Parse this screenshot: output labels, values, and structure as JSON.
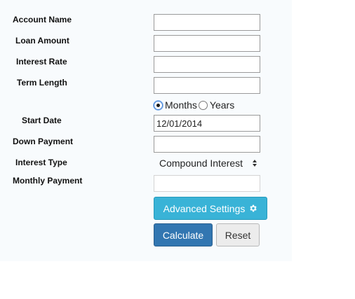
{
  "form": {
    "labels": {
      "account_name": "Account Name",
      "loan_amount": "Loan Amount",
      "interest_rate": "Interest Rate",
      "term_length": "Term Length",
      "start_date": "Start Date",
      "down_payment": "Down Payment",
      "interest_type": "Interest Type",
      "monthly_payment": "Monthly Payment"
    },
    "values": {
      "account_name": "",
      "loan_amount": "",
      "interest_rate": "",
      "term_length": "",
      "start_date": "12/01/2014",
      "down_payment": "",
      "monthly_payment": ""
    },
    "term_unit": {
      "options": [
        "Months",
        "Years"
      ],
      "selected": "Months"
    },
    "interest_type": {
      "selected": "Compound Interest"
    }
  },
  "buttons": {
    "advanced_settings": "Advanced Settings",
    "calculate": "Calculate",
    "reset": "Reset"
  },
  "icons": {
    "advanced_settings_icon": "gear-icon",
    "select_arrows_icon": "updown-arrows-icon"
  },
  "colors": {
    "info_button": "#39b3d7",
    "primary_button": "#3276b1",
    "default_button": "#ececec",
    "panel_background": "#f8fbfd"
  }
}
